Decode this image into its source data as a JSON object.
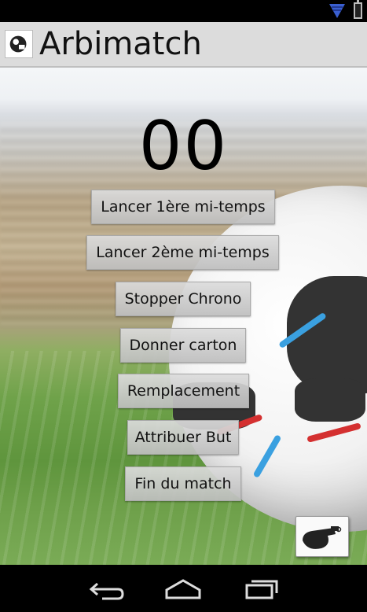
{
  "app": {
    "title": "Arbimatch"
  },
  "timer": {
    "value": "00"
  },
  "buttons": [
    {
      "label": "Lancer 1ère mi-temps"
    },
    {
      "label": "Lancer 2ème mi-temps"
    },
    {
      "label": "Stopper Chrono"
    },
    {
      "label": "Donner carton"
    },
    {
      "label": "Remplacement"
    },
    {
      "label": "Attribuer But"
    },
    {
      "label": "Fin du match"
    }
  ],
  "icons": {
    "status": [
      "wifi-icon",
      "battery-icon"
    ],
    "app": "referee-logo-icon",
    "floating": "whistle-icon",
    "nav": [
      "back-icon",
      "home-icon",
      "recent-apps-icon"
    ]
  },
  "colors": {
    "action_bar": "#dcdcdc",
    "wifi": "#3a5fd0",
    "button_bg": "#d4d4d4"
  }
}
